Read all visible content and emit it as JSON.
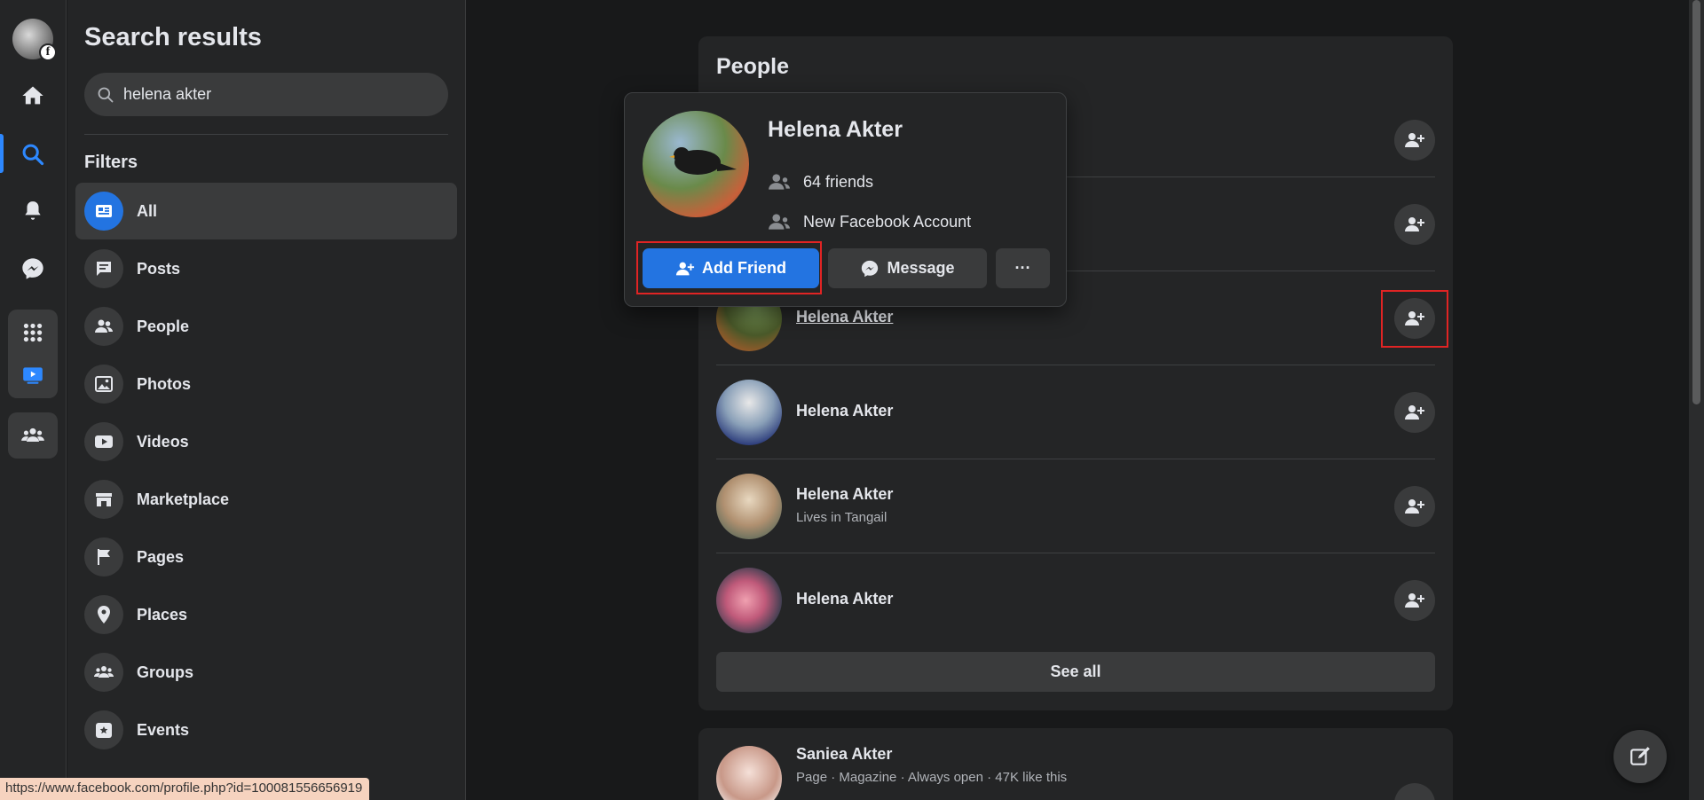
{
  "rail": {
    "items": [
      {
        "name": "home",
        "icon": "home-icon"
      },
      {
        "name": "search",
        "icon": "search-icon",
        "active": true
      },
      {
        "name": "notifications",
        "icon": "bell-icon"
      },
      {
        "name": "messenger",
        "icon": "messenger-icon"
      },
      {
        "name": "menu",
        "icon": "grid-icon"
      },
      {
        "name": "watch",
        "icon": "watch-icon"
      },
      {
        "name": "groups",
        "icon": "groups-icon"
      }
    ],
    "accent": "#2d88ff"
  },
  "sidebar": {
    "title": "Search results",
    "search": {
      "value": "helena akter"
    },
    "filters_label": "Filters",
    "filters": [
      {
        "label": "All",
        "icon": "feed-icon",
        "active": true
      },
      {
        "label": "Posts",
        "icon": "posts-icon"
      },
      {
        "label": "People",
        "icon": "people-icon"
      },
      {
        "label": "Photos",
        "icon": "photos-icon"
      },
      {
        "label": "Videos",
        "icon": "video-icon"
      },
      {
        "label": "Marketplace",
        "icon": "marketplace-icon"
      },
      {
        "label": "Pages",
        "icon": "flag-icon"
      },
      {
        "label": "Places",
        "icon": "location-pin-icon"
      },
      {
        "label": "Groups",
        "icon": "groups-icon"
      },
      {
        "label": "Events",
        "icon": "calendar-star-icon"
      }
    ]
  },
  "people": {
    "title": "People",
    "rows": [
      {
        "name": "Helena Akter",
        "sub": ""
      },
      {
        "name": "Helena Akter",
        "sub": ""
      },
      {
        "name": "Helena Akter",
        "sub": ""
      },
      {
        "name": "Helena Akter",
        "sub": ""
      },
      {
        "name": "Helena Akter",
        "sub": "Lives in Tangail"
      },
      {
        "name": "Helena Akter",
        "sub": ""
      }
    ],
    "see_all": "See all"
  },
  "page_result": {
    "name": "Saniea Akter",
    "sub": "Page · Magazine · Always open · 47K like this"
  },
  "popup": {
    "name": "Helena Akter",
    "friends": "64 friends",
    "info": "New Facebook Account",
    "add_friend": "Add Friend",
    "message": "Message",
    "more": "···"
  },
  "status_url": "https://www.facebook.com/profile.php?id=100081556656919",
  "colors": {
    "primary_button": "#2374e1",
    "highlight": "#e02424"
  }
}
